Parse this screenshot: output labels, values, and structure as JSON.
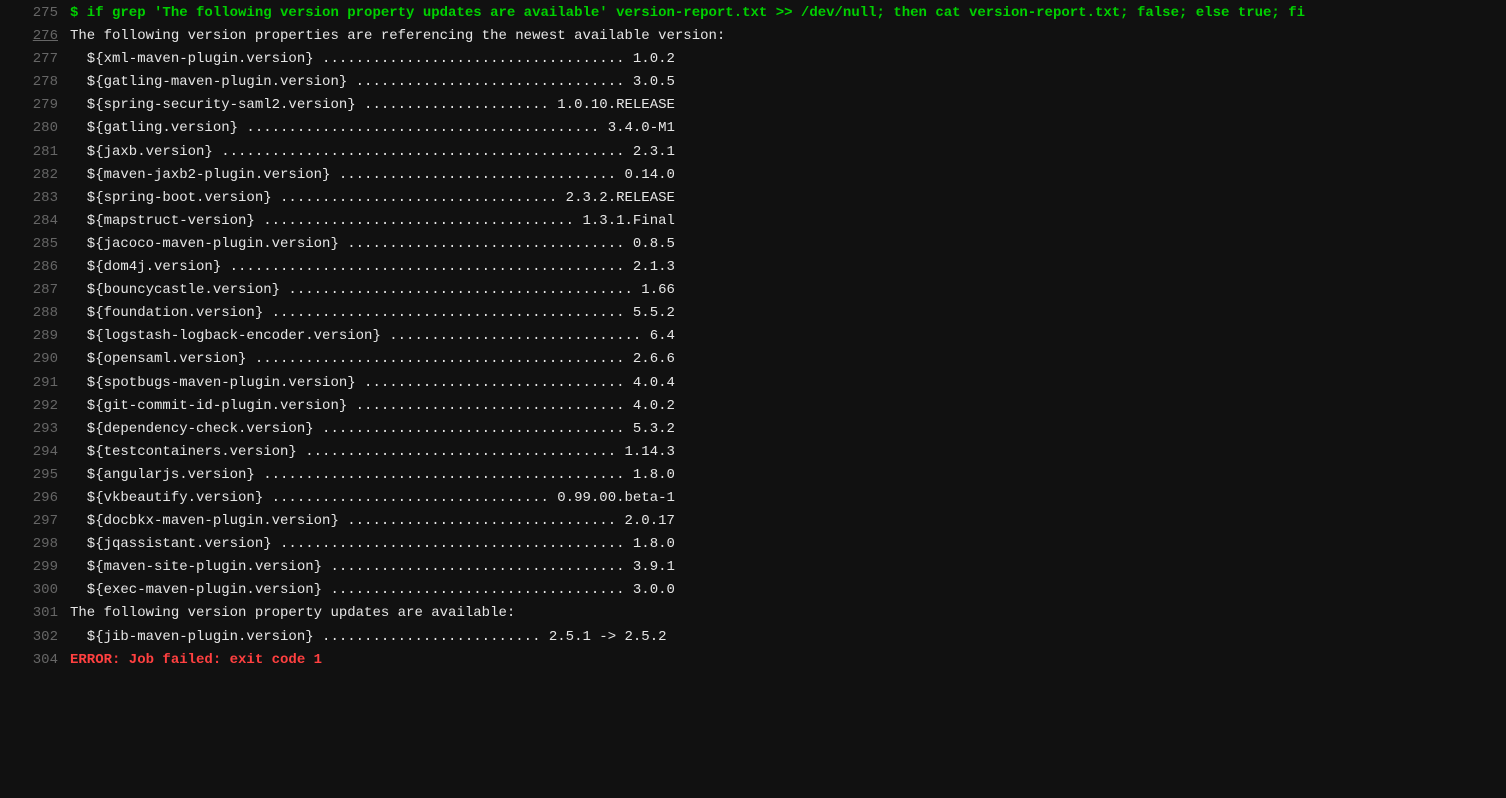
{
  "lines": [
    {
      "num": "275",
      "cls": "cmd-green",
      "underline": false,
      "text": "$ if grep 'The following version property updates are available' version-report.txt >> /dev/null; then cat version-report.txt; false; else true; fi"
    },
    {
      "num": "276",
      "cls": "plain",
      "underline": true,
      "text": "The following version properties are referencing the newest available version:"
    },
    {
      "num": "277",
      "cls": "plain",
      "underline": false,
      "text": "  ${xml-maven-plugin.version} .................................... 1.0.2"
    },
    {
      "num": "278",
      "cls": "plain",
      "underline": false,
      "text": "  ${gatling-maven-plugin.version} ................................ 3.0.5"
    },
    {
      "num": "279",
      "cls": "plain",
      "underline": false,
      "text": "  ${spring-security-saml2.version} ...................... 1.0.10.RELEASE"
    },
    {
      "num": "280",
      "cls": "plain",
      "underline": false,
      "text": "  ${gatling.version} .......................................... 3.4.0-M1"
    },
    {
      "num": "281",
      "cls": "plain",
      "underline": false,
      "text": "  ${jaxb.version} ................................................ 2.3.1"
    },
    {
      "num": "282",
      "cls": "plain",
      "underline": false,
      "text": "  ${maven-jaxb2-plugin.version} ................................. 0.14.0"
    },
    {
      "num": "283",
      "cls": "plain",
      "underline": false,
      "text": "  ${spring-boot.version} ................................. 2.3.2.RELEASE"
    },
    {
      "num": "284",
      "cls": "plain",
      "underline": false,
      "text": "  ${mapstruct-version} ..................................... 1.3.1.Final"
    },
    {
      "num": "285",
      "cls": "plain",
      "underline": false,
      "text": "  ${jacoco-maven-plugin.version} ................................. 0.8.5"
    },
    {
      "num": "286",
      "cls": "plain",
      "underline": false,
      "text": "  ${dom4j.version} ............................................... 2.1.3"
    },
    {
      "num": "287",
      "cls": "plain",
      "underline": false,
      "text": "  ${bouncycastle.version} ......................................... 1.66"
    },
    {
      "num": "288",
      "cls": "plain",
      "underline": false,
      "text": "  ${foundation.version} .......................................... 5.5.2"
    },
    {
      "num": "289",
      "cls": "plain",
      "underline": false,
      "text": "  ${logstash-logback-encoder.version} .............................. 6.4"
    },
    {
      "num": "290",
      "cls": "plain",
      "underline": false,
      "text": "  ${opensaml.version} ............................................ 2.6.6"
    },
    {
      "num": "291",
      "cls": "plain",
      "underline": false,
      "text": "  ${spotbugs-maven-plugin.version} ............................... 4.0.4"
    },
    {
      "num": "292",
      "cls": "plain",
      "underline": false,
      "text": "  ${git-commit-id-plugin.version} ................................ 4.0.2"
    },
    {
      "num": "293",
      "cls": "plain",
      "underline": false,
      "text": "  ${dependency-check.version} .................................... 5.3.2"
    },
    {
      "num": "294",
      "cls": "plain",
      "underline": false,
      "text": "  ${testcontainers.version} ..................................... 1.14.3"
    },
    {
      "num": "295",
      "cls": "plain",
      "underline": false,
      "text": "  ${angularjs.version} ........................................... 1.8.0"
    },
    {
      "num": "296",
      "cls": "plain",
      "underline": false,
      "text": "  ${vkbeautify.version} ................................. 0.99.00.beta-1"
    },
    {
      "num": "297",
      "cls": "plain",
      "underline": false,
      "text": "  ${docbkx-maven-plugin.version} ................................ 2.0.17"
    },
    {
      "num": "298",
      "cls": "plain",
      "underline": false,
      "text": "  ${jqassistant.version} ......................................... 1.8.0"
    },
    {
      "num": "299",
      "cls": "plain",
      "underline": false,
      "text": "  ${maven-site-plugin.version} ................................... 3.9.1"
    },
    {
      "num": "300",
      "cls": "plain",
      "underline": false,
      "text": "  ${exec-maven-plugin.version} ................................... 3.0.0"
    },
    {
      "num": "301",
      "cls": "plain",
      "underline": false,
      "text": "The following version property updates are available:"
    },
    {
      "num": "302",
      "cls": "plain",
      "underline": false,
      "text": "  ${jib-maven-plugin.version} .......................... 2.5.1 -> 2.5.2"
    },
    {
      "num": "304",
      "cls": "error-red",
      "underline": false,
      "text": "ERROR: Job failed: exit code 1"
    }
  ]
}
